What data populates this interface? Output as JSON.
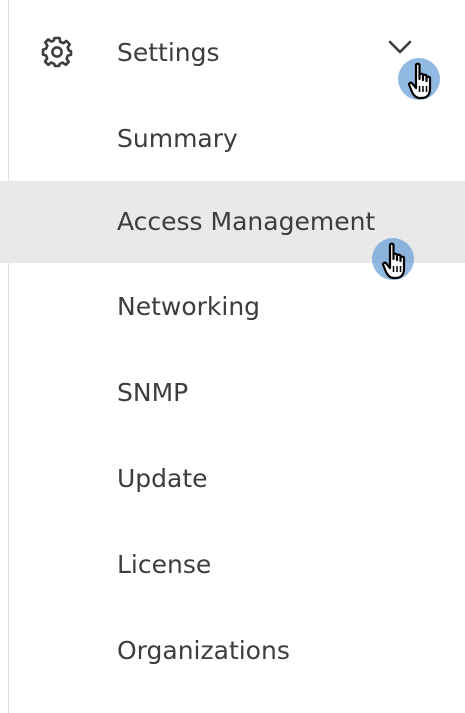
{
  "settings": {
    "label": "Settings",
    "icon": "gear-icon",
    "expand_icon": "chevron-down-icon",
    "expanded": true
  },
  "menu": {
    "items": [
      {
        "label": "Summary",
        "active": false
      },
      {
        "label": "Access Management",
        "active": true
      },
      {
        "label": "Networking",
        "active": false
      },
      {
        "label": "SNMP",
        "active": false
      },
      {
        "label": "Update",
        "active": false
      },
      {
        "label": "License",
        "active": false
      },
      {
        "label": "Organizations",
        "active": false
      }
    ]
  },
  "colors": {
    "text": "#3d3d3d",
    "active_bg": "#e9e9e9",
    "cursor_halo": "#689ed6",
    "border": "#dcdcdc"
  }
}
